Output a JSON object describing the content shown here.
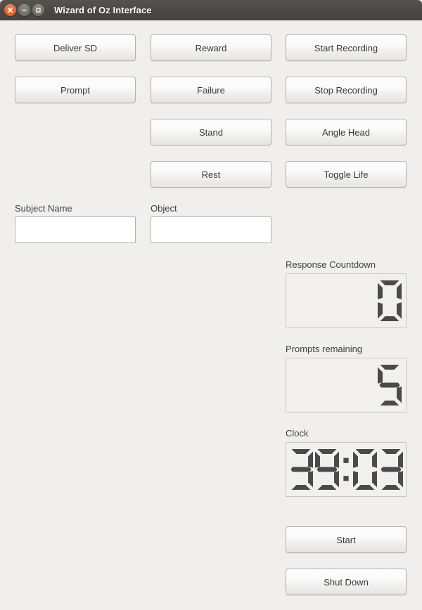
{
  "window": {
    "title": "Wizard of Oz Interface",
    "controls": [
      {
        "name": "close",
        "glyph": "x"
      },
      {
        "name": "minimize",
        "glyph": "minus"
      },
      {
        "name": "maximize",
        "glyph": "square"
      }
    ],
    "titlebar_color": "#4b4945",
    "background_color": "#f0efed"
  },
  "buttons": {
    "deliver_sd": "Deliver SD",
    "prompt": "Prompt",
    "reward": "Reward",
    "failure": "Failure",
    "stand": "Stand",
    "rest": "Rest",
    "start_recording": "Start Recording",
    "stop_recording": "Stop Recording",
    "angle_head": "Angle Head",
    "toggle_life": "Toggle Life",
    "start": "Start",
    "shut_down": "Shut Down"
  },
  "fields": {
    "subject_name": {
      "label": "Subject Name",
      "value": "",
      "placeholder": ""
    },
    "object": {
      "label": "Object",
      "value": "",
      "placeholder": ""
    }
  },
  "displays": {
    "response_countdown": {
      "label": "Response Countdown",
      "value": "0",
      "digits": 1
    },
    "prompts_remaining": {
      "label": "Prompts remaining",
      "value": "5",
      "digits": 1
    },
    "clock": {
      "label": "Clock",
      "value": "39:03",
      "digits": 5
    }
  },
  "colors": {
    "segment_on": "#4a4a4a",
    "lcd_background": "#f1f0ee",
    "button_border": "#b4b0ab",
    "text": "#3f3e3c",
    "close_button": "#e4692e"
  }
}
